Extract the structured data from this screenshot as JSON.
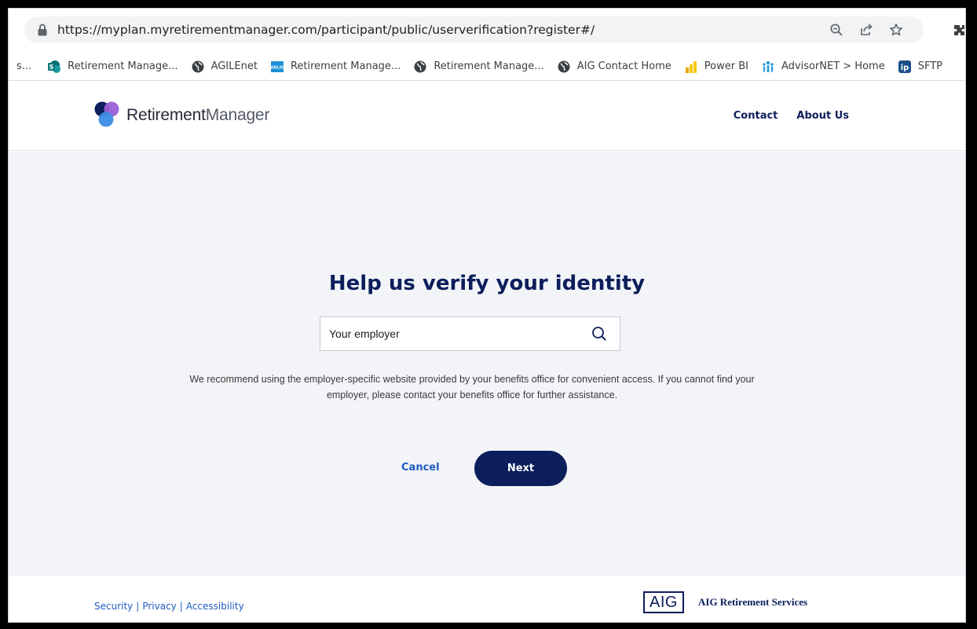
{
  "browser": {
    "url": "https://myplan.myretirementmanager.com/participant/public/userverification?register#/",
    "bookmarks": [
      {
        "label": "s...",
        "icon": "truncated-bookmark",
        "color": "#5f6368"
      },
      {
        "label": "Retirement Manage...",
        "icon": "sharepoint-icon",
        "color": "#038387"
      },
      {
        "label": "AGILEnet",
        "icon": "globe-icon",
        "color": "#3c4043"
      },
      {
        "label": "Retirement Manage...",
        "icon": "valic-icon",
        "color": "#1e90d6"
      },
      {
        "label": "Retirement Manage...",
        "icon": "globe-icon",
        "color": "#3c4043"
      },
      {
        "label": "AIG Contact Home",
        "icon": "globe-icon",
        "color": "#3c4043"
      },
      {
        "label": "Power BI",
        "icon": "powerbi-icon",
        "color": "#f2c811"
      },
      {
        "label": "AdvisorNET > Home",
        "icon": "advisornet-icon",
        "color": "#2a9fd6"
      },
      {
        "label": "SFTP",
        "icon": "ip-icon",
        "color": "#1c4f8a"
      }
    ]
  },
  "header": {
    "logo_bold": "Retirement",
    "logo_light": "Manager",
    "nav": [
      "Contact",
      "About Us"
    ]
  },
  "main": {
    "title": "Help us verify your identity",
    "search": {
      "placeholder": "Your employer",
      "value": ""
    },
    "help_text": "We recommend using the employer-specific website provided by your benefits office for convenient access. If you cannot find your employer, please contact your benefits office for further assistance.",
    "cancel_label": "Cancel",
    "next_label": "Next"
  },
  "footer": {
    "links": [
      "Security",
      "Privacy",
      "Accessibility"
    ],
    "brand_logo": "AIG",
    "brand_name": "AIG Retirement Services"
  },
  "colors": {
    "navy": "#0c1e5b",
    "link_blue": "#1f5bc1",
    "page_bg": "#f2f4f8"
  }
}
